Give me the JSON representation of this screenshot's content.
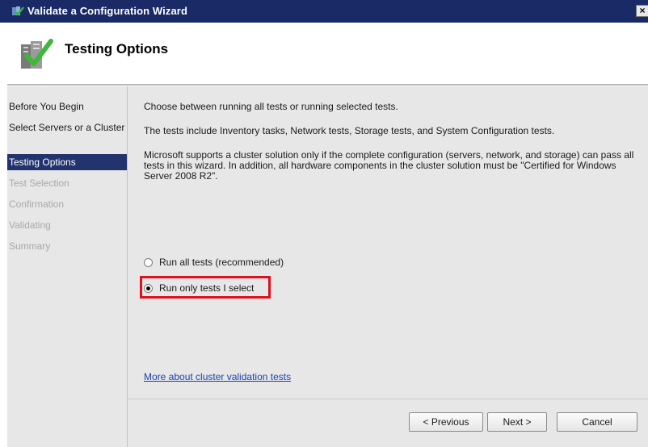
{
  "window": {
    "title": "Validate a Configuration Wizard",
    "close_label": "×"
  },
  "header": {
    "title": "Testing Options",
    "icon": "wizard-checkmark-icon"
  },
  "nav": {
    "items": [
      {
        "label": "Before You Begin",
        "state": "normal"
      },
      {
        "label": "Select Servers or a Cluster",
        "state": "normal"
      },
      {
        "label": "Testing Options",
        "state": "active"
      },
      {
        "label": "Test Selection",
        "state": "disabled"
      },
      {
        "label": "Confirmation",
        "state": "disabled"
      },
      {
        "label": "Validating",
        "state": "disabled"
      },
      {
        "label": "Summary",
        "state": "disabled"
      }
    ]
  },
  "content": {
    "intro": "Choose between running all tests or running selected tests.",
    "tests_info": "The tests include Inventory tasks, Network tests, Storage tests, and System Configuration tests.",
    "support_info": "Microsoft supports a cluster solution only if the complete configuration (servers, network, and storage) can pass all tests in this wizard. In addition, all hardware components in the cluster solution must be \"Certified for Windows Server 2008 R2\".",
    "options": [
      {
        "label": "Run all tests (recommended)",
        "checked": false
      },
      {
        "label": "Run only tests I select",
        "checked": true
      }
    ],
    "more_link": "More about cluster validation tests"
  },
  "footer": {
    "previous": "< Previous",
    "next": "Next >",
    "cancel": "Cancel"
  },
  "colors": {
    "title_bar": "#1a2a66",
    "active_nav": "#22336e",
    "highlight": "#e0101a",
    "link": "#1a3fae"
  }
}
